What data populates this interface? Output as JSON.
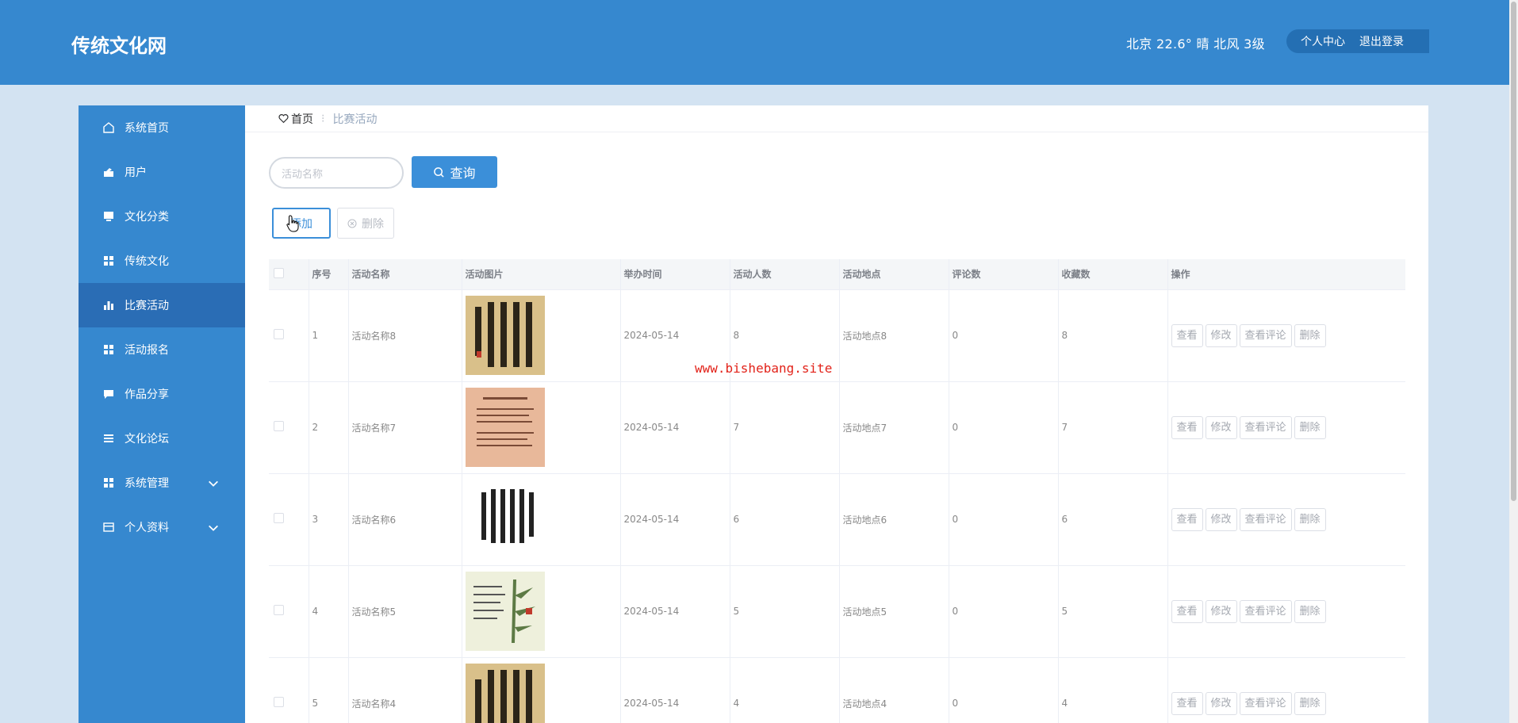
{
  "header": {
    "brand": "传统文化网",
    "weather": "北京  22.6°  晴  北风  3级",
    "personal_center": "个人中心",
    "logout": "退出登录"
  },
  "sidebar": {
    "items": [
      {
        "label": "系统首页",
        "icon": "home-icon"
      },
      {
        "label": "用户",
        "icon": "user-icon"
      },
      {
        "label": "文化分类",
        "icon": "monitor-icon"
      },
      {
        "label": "传统文化",
        "icon": "grid-icon"
      },
      {
        "label": "比赛活动",
        "icon": "bar-chart-icon",
        "active": true
      },
      {
        "label": "活动报名",
        "icon": "grid-icon"
      },
      {
        "label": "作品分享",
        "icon": "chat-icon"
      },
      {
        "label": "文化论坛",
        "icon": "list-icon"
      },
      {
        "label": "系统管理",
        "icon": "grid-icon",
        "expandable": true
      },
      {
        "label": "个人资料",
        "icon": "wallet-icon",
        "expandable": true
      }
    ]
  },
  "breadcrumb": {
    "home": "首页",
    "current": "比赛活动"
  },
  "search": {
    "placeholder": "活动名称",
    "button": "查询"
  },
  "actions": {
    "add": "添加",
    "delete": "删除"
  },
  "table": {
    "columns": [
      "序号",
      "活动名称",
      "活动图片",
      "举办时间",
      "活动人数",
      "活动地点",
      "评论数",
      "收藏数",
      "操作"
    ],
    "row_actions": [
      "查看",
      "修改",
      "查看评论",
      "删除"
    ],
    "rows": [
      {
        "no": "1",
        "name": "活动名称8",
        "image": "calligraphy-vertical-scroll",
        "date": "2024-05-14",
        "people": "8",
        "place": "活动地点8",
        "comments": "0",
        "favorites": "8"
      },
      {
        "no": "2",
        "name": "活动名称7",
        "image": "calligraphy-pink-paper",
        "date": "2024-05-14",
        "people": "7",
        "place": "活动地点7",
        "comments": "0",
        "favorites": "7"
      },
      {
        "no": "3",
        "name": "活动名称6",
        "image": "calligraphy-white-paper",
        "date": "2024-05-14",
        "people": "6",
        "place": "活动地点6",
        "comments": "0",
        "favorites": "6"
      },
      {
        "no": "4",
        "name": "活动名称5",
        "image": "calligraphy-bamboo",
        "date": "2024-05-14",
        "people": "5",
        "place": "活动地点5",
        "comments": "0",
        "favorites": "5"
      },
      {
        "no": "5",
        "name": "活动名称4",
        "image": "calligraphy-vertical-scroll",
        "date": "2024-05-14",
        "people": "4",
        "place": "活动地点4",
        "comments": "0",
        "favorites": "4"
      }
    ]
  },
  "watermark": "www.bishebang.site",
  "colors": {
    "primary": "#3688cf",
    "active": "#2a6db5",
    "button": "#3b8fd9"
  }
}
